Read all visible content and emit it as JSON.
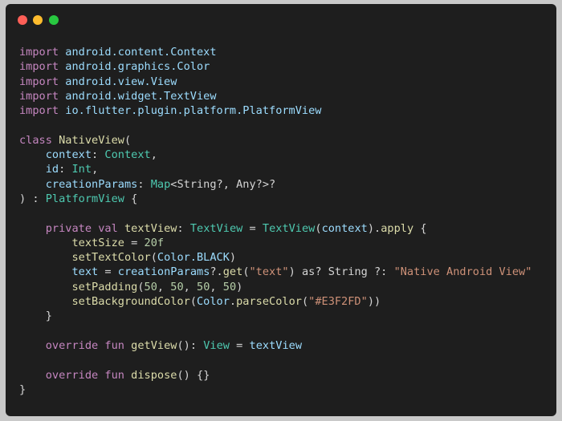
{
  "window": {
    "controls": [
      {
        "name": "close",
        "color": "#ff5f57"
      },
      {
        "name": "minimize",
        "color": "#febc2e"
      },
      {
        "name": "maximize",
        "color": "#28c840"
      }
    ]
  },
  "code": {
    "lines": [
      [
        {
          "t": "kw",
          "s": "import"
        },
        {
          "t": "plain",
          "s": " "
        },
        {
          "t": "id",
          "s": "android.content.Context"
        }
      ],
      [
        {
          "t": "kw",
          "s": "import"
        },
        {
          "t": "plain",
          "s": " "
        },
        {
          "t": "id",
          "s": "android.graphics.Color"
        }
      ],
      [
        {
          "t": "kw",
          "s": "import"
        },
        {
          "t": "plain",
          "s": " "
        },
        {
          "t": "id",
          "s": "android.view.View"
        }
      ],
      [
        {
          "t": "kw",
          "s": "import"
        },
        {
          "t": "plain",
          "s": " "
        },
        {
          "t": "id",
          "s": "android.widget.TextView"
        }
      ],
      [
        {
          "t": "kw",
          "s": "import"
        },
        {
          "t": "plain",
          "s": " "
        },
        {
          "t": "id",
          "s": "io.flutter.plugin.platform.PlatformView"
        }
      ],
      [],
      [
        {
          "t": "kw",
          "s": "class"
        },
        {
          "t": "plain",
          "s": " "
        },
        {
          "t": "fn",
          "s": "NativeView"
        },
        {
          "t": "plain",
          "s": "("
        }
      ],
      [
        {
          "t": "plain",
          "s": "    "
        },
        {
          "t": "id",
          "s": "context"
        },
        {
          "t": "plain",
          "s": ": "
        },
        {
          "t": "type",
          "s": "Context"
        },
        {
          "t": "plain",
          "s": ","
        }
      ],
      [
        {
          "t": "plain",
          "s": "    "
        },
        {
          "t": "id",
          "s": "id"
        },
        {
          "t": "plain",
          "s": ": "
        },
        {
          "t": "type",
          "s": "Int"
        },
        {
          "t": "plain",
          "s": ","
        }
      ],
      [
        {
          "t": "plain",
          "s": "    "
        },
        {
          "t": "id",
          "s": "creationParams"
        },
        {
          "t": "plain",
          "s": ": "
        },
        {
          "t": "type",
          "s": "Map"
        },
        {
          "t": "plain",
          "s": "<String?, Any?>?"
        }
      ],
      [
        {
          "t": "plain",
          "s": ") : "
        },
        {
          "t": "type",
          "s": "PlatformView"
        },
        {
          "t": "plain",
          "s": " {"
        }
      ],
      [],
      [
        {
          "t": "plain",
          "s": "    "
        },
        {
          "t": "kw",
          "s": "private"
        },
        {
          "t": "plain",
          "s": " "
        },
        {
          "t": "kw",
          "s": "val"
        },
        {
          "t": "plain",
          "s": " "
        },
        {
          "t": "fn",
          "s": "textView"
        },
        {
          "t": "plain",
          "s": ": "
        },
        {
          "t": "type",
          "s": "TextView"
        },
        {
          "t": "plain",
          "s": " = "
        },
        {
          "t": "type",
          "s": "TextView"
        },
        {
          "t": "plain",
          "s": "("
        },
        {
          "t": "id",
          "s": "context"
        },
        {
          "t": "plain",
          "s": ")."
        },
        {
          "t": "fn",
          "s": "apply"
        },
        {
          "t": "plain",
          "s": " {"
        }
      ],
      [
        {
          "t": "plain",
          "s": "        "
        },
        {
          "t": "fn",
          "s": "textSize"
        },
        {
          "t": "plain",
          "s": " = "
        },
        {
          "t": "num",
          "s": "20f"
        }
      ],
      [
        {
          "t": "plain",
          "s": "        "
        },
        {
          "t": "fn",
          "s": "setTextColor"
        },
        {
          "t": "plain",
          "s": "("
        },
        {
          "t": "id",
          "s": "Color.BLACK"
        },
        {
          "t": "plain",
          "s": ")"
        }
      ],
      [
        {
          "t": "plain",
          "s": "        "
        },
        {
          "t": "id",
          "s": "text"
        },
        {
          "t": "plain",
          "s": " = "
        },
        {
          "t": "id",
          "s": "creationParams"
        },
        {
          "t": "plain",
          "s": "?."
        },
        {
          "t": "fn",
          "s": "get"
        },
        {
          "t": "plain",
          "s": "("
        },
        {
          "t": "str",
          "s": "\"text\""
        },
        {
          "t": "plain",
          "s": ") as? String ?: "
        },
        {
          "t": "str",
          "s": "\"Native Android View\""
        }
      ],
      [
        {
          "t": "plain",
          "s": "        "
        },
        {
          "t": "fn",
          "s": "setPadding"
        },
        {
          "t": "plain",
          "s": "("
        },
        {
          "t": "num",
          "s": "50"
        },
        {
          "t": "plain",
          "s": ", "
        },
        {
          "t": "num",
          "s": "50"
        },
        {
          "t": "plain",
          "s": ", "
        },
        {
          "t": "num",
          "s": "50"
        },
        {
          "t": "plain",
          "s": ", "
        },
        {
          "t": "num",
          "s": "50"
        },
        {
          "t": "plain",
          "s": ")"
        }
      ],
      [
        {
          "t": "plain",
          "s": "        "
        },
        {
          "t": "fn",
          "s": "setBackgroundColor"
        },
        {
          "t": "plain",
          "s": "("
        },
        {
          "t": "id",
          "s": "Color"
        },
        {
          "t": "plain",
          "s": "."
        },
        {
          "t": "fn",
          "s": "parseColor"
        },
        {
          "t": "plain",
          "s": "("
        },
        {
          "t": "str",
          "s": "\"#E3F2FD\""
        },
        {
          "t": "plain",
          "s": "))"
        }
      ],
      [
        {
          "t": "plain",
          "s": "    }"
        }
      ],
      [],
      [
        {
          "t": "plain",
          "s": "    "
        },
        {
          "t": "kw",
          "s": "override"
        },
        {
          "t": "plain",
          "s": " "
        },
        {
          "t": "kw",
          "s": "fun"
        },
        {
          "t": "plain",
          "s": " "
        },
        {
          "t": "fn",
          "s": "getView"
        },
        {
          "t": "plain",
          "s": "(): "
        },
        {
          "t": "type",
          "s": "View"
        },
        {
          "t": "plain",
          "s": " = "
        },
        {
          "t": "id",
          "s": "textView"
        }
      ],
      [],
      [
        {
          "t": "plain",
          "s": "    "
        },
        {
          "t": "kw",
          "s": "override"
        },
        {
          "t": "plain",
          "s": " "
        },
        {
          "t": "kw",
          "s": "fun"
        },
        {
          "t": "plain",
          "s": " "
        },
        {
          "t": "fn",
          "s": "dispose"
        },
        {
          "t": "plain",
          "s": "() {}"
        }
      ],
      [
        {
          "t": "plain",
          "s": "}"
        }
      ]
    ]
  }
}
